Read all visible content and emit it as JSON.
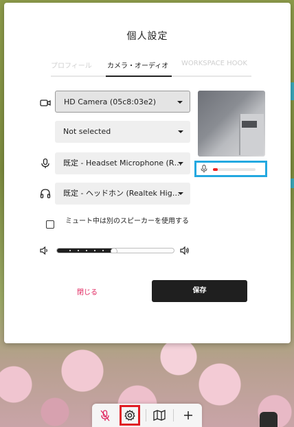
{
  "dialog": {
    "title": "個人設定",
    "tabs": [
      {
        "label": "プロフィール",
        "active": false
      },
      {
        "label": "カメラ・オーディオ",
        "active": true
      },
      {
        "label": "WORKSPACE HOOK",
        "active": false
      }
    ]
  },
  "camera": {
    "icon": "video-camera-icon",
    "selected": "HD Camera (05c8:03e2)"
  },
  "camera_secondary": {
    "selected": "Not selected"
  },
  "microphone": {
    "icon": "microphone-icon",
    "selected": "既定 - Headset Microphone (R…",
    "level_fraction": 0.12,
    "level_color": "#ee2222"
  },
  "speaker": {
    "icon": "headphones-icon",
    "selected": "既定 - ヘッドホン (Realtek Hig…"
  },
  "mute_option": {
    "checked": false,
    "label": "ミュート中は別のスピーカーを使用する"
  },
  "volume": {
    "level_fraction": 0.48,
    "low_icon": "volume-low-icon",
    "high_icon": "volume-high-icon"
  },
  "actions": {
    "close_label": "閉じる",
    "save_label": "保存"
  },
  "toolbar": {
    "items": [
      "mic-muted-icon",
      "gear-icon",
      "map-icon",
      "plus-icon"
    ],
    "highlighted": "gear-icon"
  },
  "colors": {
    "accent_red": "#e0245e",
    "highlight_blue": "#23a8e0",
    "highlight_red": "#e01b24",
    "primary_button": "#1f1f1f"
  }
}
